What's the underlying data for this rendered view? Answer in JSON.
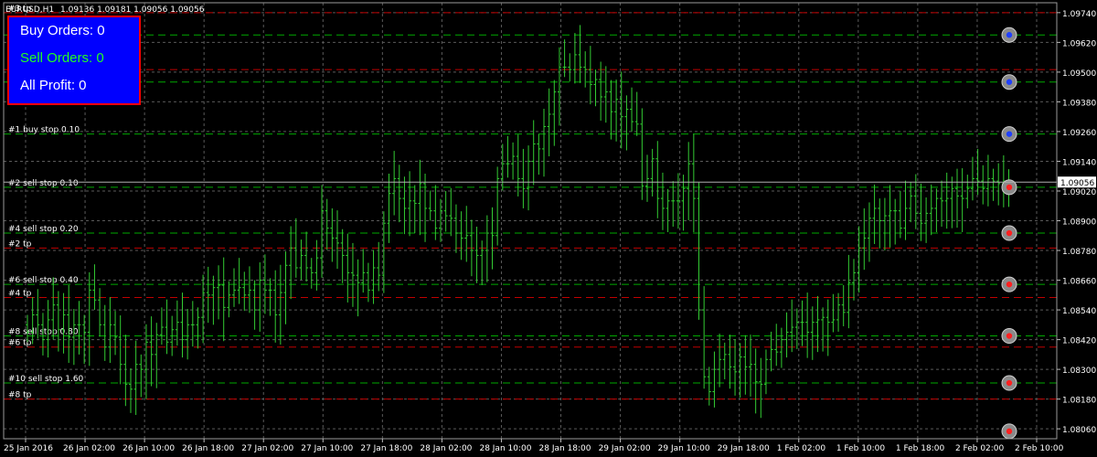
{
  "header": {
    "symbol": "EURUSD,H1",
    "ohlc": "1.09136 1.09181 1.09056 1.09056"
  },
  "info_panel": {
    "buy_orders": "Buy Orders: 0",
    "sell_orders": "Sell Orders: 0",
    "all_profit": "All Profit: 0"
  },
  "colors": {
    "background": "#000000",
    "grid": "#5a5a5a",
    "candle": "#33cc33",
    "green_line": "#00a800",
    "red_line": "#c00000",
    "panel_bg": "#0000ff",
    "panel_border": "#ff0000",
    "sell_text": "#22ff22"
  },
  "price_axis": {
    "labels": [
      "1.09740",
      "1.09620",
      "1.09500",
      "1.09380",
      "1.09260",
      "1.09140",
      "1.09020",
      "1.08900",
      "1.08780",
      "1.08660",
      "1.08540",
      "1.08420",
      "1.08300",
      "1.08180",
      "1.08060"
    ],
    "current_price": "1.09056"
  },
  "time_axis": {
    "labels": [
      "25 Jan 2016",
      "26 Jan 02:00",
      "26 Jan 10:00",
      "26 Jan 18:00",
      "27 Jan 02:00",
      "27 Jan 10:00",
      "27 Jan 18:00",
      "28 Jan 02:00",
      "28 Jan 10:00",
      "28 Jan 18:00",
      "29 Jan 02:00",
      "29 Jan 10:00",
      "29 Jan 18:00",
      "1 Feb 02:00",
      "1 Feb 10:00",
      "1 Feb 18:00",
      "2 Feb 02:00",
      "2 Feb 10:00"
    ]
  },
  "order_lines": [
    {
      "label": "#3 tp",
      "price": 1.0974,
      "color": "red",
      "marker": "none"
    },
    {
      "label": "",
      "price": 1.0965,
      "color": "green",
      "marker": "blue"
    },
    {
      "label": "",
      "price": 1.0951,
      "color": "red",
      "marker": "none"
    },
    {
      "label": "",
      "price": 1.0946,
      "color": "green",
      "marker": "blue"
    },
    {
      "label": "#1 buy stop 0.10",
      "price": 1.0925,
      "color": "green",
      "marker": "blue"
    },
    {
      "label": "#2 sell stop 0.10",
      "price": 1.09035,
      "color": "green",
      "marker": "red"
    },
    {
      "label": "#4 sell stop 0.20",
      "price": 1.0885,
      "color": "green",
      "marker": "red"
    },
    {
      "label": "#2 tp",
      "price": 1.0879,
      "color": "red",
      "marker": "none"
    },
    {
      "label": "#6 sell stop 0.40",
      "price": 1.08643,
      "color": "green",
      "marker": "red"
    },
    {
      "label": "#4 tp",
      "price": 1.0859,
      "color": "red",
      "marker": "none"
    },
    {
      "label": "#8 sell stop 0.80",
      "price": 1.08435,
      "color": "green",
      "marker": "red"
    },
    {
      "label": "#6 tp",
      "price": 1.0839,
      "color": "red",
      "marker": "none"
    },
    {
      "label": "#10 sell stop 1.60",
      "price": 1.08245,
      "color": "green",
      "marker": "red"
    },
    {
      "label": "#8 tp",
      "price": 1.0818,
      "color": "red",
      "marker": "none"
    },
    {
      "label": "",
      "price": 1.0805,
      "color": "none",
      "marker": "red"
    }
  ],
  "chart_data": {
    "type": "bar",
    "symbol": "EURUSD",
    "timeframe": "H1",
    "ylim": [
      1.0802,
      1.0978
    ],
    "close_series": [
      1.0845,
      1.0852,
      1.0848,
      1.0842,
      1.085,
      1.0856,
      1.0846,
      1.0852,
      1.0843,
      1.0848,
      1.0848,
      1.0845,
      1.0862,
      1.0858,
      1.0848,
      1.0839,
      1.0848,
      1.0843,
      1.0832,
      1.0824,
      1.0822,
      1.0832,
      1.083,
      1.0841,
      1.0836,
      1.0844,
      1.0847,
      1.0841,
      1.0846,
      1.0849,
      1.0842,
      1.0848,
      1.0848,
      1.0851,
      1.0861,
      1.086,
      1.0863,
      1.0864,
      1.0855,
      1.086,
      1.0862,
      1.0863,
      1.086,
      1.0862,
      1.0854,
      1.0866,
      1.0862,
      1.0862,
      1.0852,
      1.0861,
      1.0872,
      1.0879,
      1.0871,
      1.0876,
      1.0871,
      1.0869,
      1.0875,
      1.0894,
      1.0887,
      1.0883,
      1.0881,
      1.0876,
      1.0869,
      1.0868,
      1.0865,
      1.0869,
      1.0862,
      1.0871,
      1.0868,
      1.0889,
      1.0901,
      1.0907,
      1.0899,
      1.0895,
      1.0898,
      1.0897,
      1.0905,
      1.0895,
      1.0894,
      1.0887,
      1.0894,
      1.0892,
      1.0891,
      1.0885,
      1.0883,
      1.0884,
      1.0878,
      1.0876,
      1.0878,
      1.0885,
      1.0884,
      1.0907,
      1.0913,
      1.0913,
      1.0916,
      1.0907,
      1.0903,
      1.0914,
      1.0921,
      1.0919,
      1.0928,
      1.0933,
      1.0942,
      1.0952,
      1.0952,
      1.0951,
      1.0957,
      1.0952,
      1.0951,
      1.0945,
      1.0947,
      1.094,
      1.0942,
      1.0934,
      1.0939,
      1.0932,
      1.0935,
      1.093,
      1.0929,
      1.0904,
      1.0907,
      1.0915,
      1.0899,
      1.0895,
      1.0898,
      1.0898,
      1.0898,
      1.0903,
      1.0913,
      1.0899,
      1.0854,
      1.0827,
      1.0821,
      1.083,
      1.0834,
      1.0836,
      1.0831,
      1.0829,
      1.0835,
      1.0831,
      1.0832,
      1.0825,
      1.0824,
      1.0834,
      1.0838,
      1.0837,
      1.0842,
      1.0845,
      1.0847,
      1.0849,
      1.0849,
      1.0845,
      1.0849,
      1.085,
      1.0851,
      1.0849,
      1.085,
      1.0856,
      1.0853,
      1.0865,
      1.0869,
      1.0879,
      1.0883,
      1.0891,
      1.0895,
      1.089,
      1.0892,
      1.0894,
      1.0894,
      1.0887,
      1.0895,
      1.09,
      1.0893,
      1.0889,
      1.0893,
      1.0895,
      1.0899,
      1.0898,
      1.0899,
      1.0903,
      1.09,
      1.0899,
      1.0903,
      1.0907,
      1.0906,
      1.0903,
      1.0907,
      1.0906,
      1.0905,
      1.0906,
      1.0906
    ]
  }
}
